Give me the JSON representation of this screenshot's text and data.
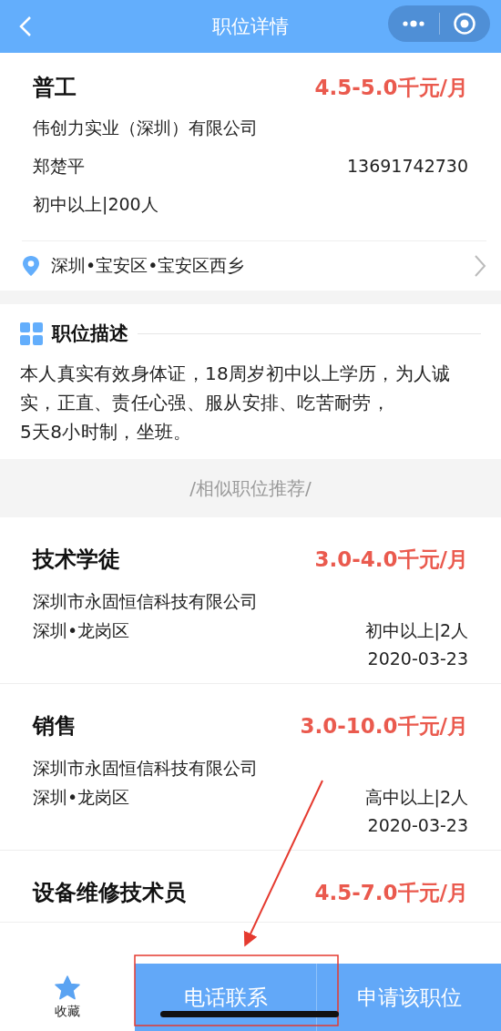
{
  "nav_bar": {
    "title": "职位详情"
  },
  "job": {
    "title": "普工",
    "salary": "4.5-5.0千元/月",
    "company": "伟创力实业（深圳）有限公司",
    "contact_name": "郑楚平",
    "phone": "13691742730",
    "requirements": "初中以上|200人",
    "location": "深圳•宝安区•宝安区西乡"
  },
  "description": {
    "title": "职位描述",
    "text": "本人真实有效身体证，18周岁初中以上学历，为人诚实，正直、责任心强、服从安排、吃苦耐劳，\n5天8小时制，坐班。"
  },
  "similar_header": "/相似职位推荐/",
  "similar_jobs": [
    {
      "title": "技术学徒",
      "salary": "3.0-4.0千元/月",
      "company": "深圳市永固恒信科技有限公司",
      "location": "深圳•龙岗区",
      "requirements": "初中以上|2人",
      "date": "2020-03-23"
    },
    {
      "title": "销售",
      "salary": "3.0-10.0千元/月",
      "company": "深圳市永固恒信科技有限公司",
      "location": "深圳•龙岗区",
      "requirements": "高中以上|2人",
      "date": "2020-03-23"
    },
    {
      "title": "设备维修技术员",
      "salary": "4.5-7.0千元/月"
    }
  ],
  "bottom_bar": {
    "favorite_label": "收藏",
    "call_button": "电话联系",
    "apply_button": "申请该职位"
  }
}
